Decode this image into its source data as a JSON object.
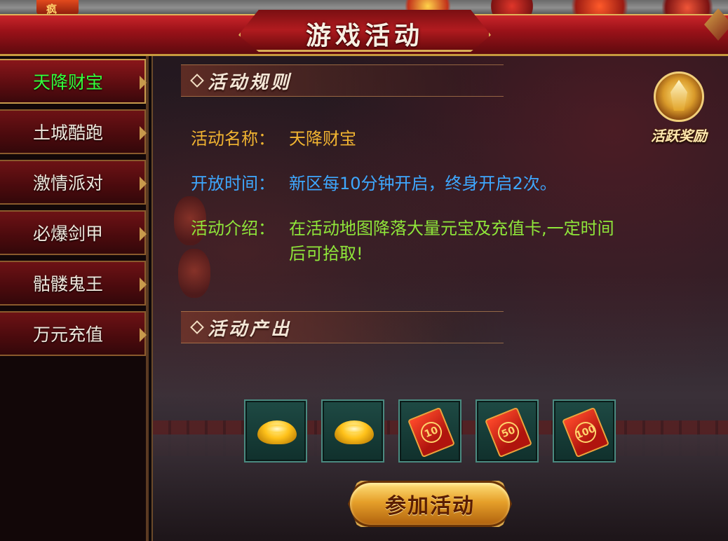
{
  "top_glyph": "疯",
  "title": "游戏活动",
  "sidebar": {
    "items": [
      {
        "label": "天降财宝",
        "active": true
      },
      {
        "label": "土城酷跑",
        "active": false
      },
      {
        "label": "激情派对",
        "active": false
      },
      {
        "label": "必爆剑甲",
        "active": false
      },
      {
        "label": "骷髅鬼王",
        "active": false
      },
      {
        "label": "万元充值",
        "active": false
      }
    ]
  },
  "rules": {
    "heading": "活动规则",
    "name_key": "活动名称：",
    "name_value": "天降财宝",
    "time_key": "开放时间：",
    "time_value": "新区每10分钟开启，终身开启2次。",
    "intro_key": "活动介绍：",
    "intro_line1": "在活动地图降落大量元宝及充值卡,一定时间",
    "intro_line2": "后可拾取!"
  },
  "badge": {
    "label": "活跃奖励",
    "icon": "crown-crest-icon"
  },
  "output": {
    "heading": "活动产出",
    "items": [
      {
        "type": "gold-ingot-icon"
      },
      {
        "type": "gold-ingot-icon"
      },
      {
        "type": "recharge-card-icon",
        "amount": "10"
      },
      {
        "type": "recharge-card-icon",
        "amount": "50"
      },
      {
        "type": "recharge-card-icon",
        "amount": "100"
      }
    ]
  },
  "join_button": "参加活动",
  "colors": {
    "active_tab": "#34ff3b",
    "name_text": "#f1b431",
    "time_text": "#3ea8ff",
    "intro_text": "#8fe63a"
  }
}
